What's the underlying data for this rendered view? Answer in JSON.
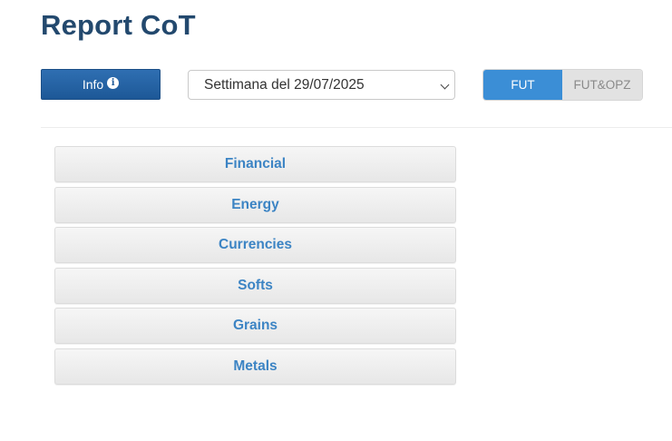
{
  "header": {
    "title": "Report CoT"
  },
  "toolbar": {
    "info_label": "Info",
    "info_icon": "info-circle-icon",
    "week_select": {
      "selected": "Settimana del 29/07/2025"
    },
    "mode_toggle": {
      "options": [
        {
          "label": "FUT",
          "active": true
        },
        {
          "label": "FUT&OPZ",
          "active": false
        }
      ],
      "active_color": "#3b8ed6",
      "inactive_color": "#e2e2e2"
    }
  },
  "categories": [
    {
      "label": "Financial"
    },
    {
      "label": "Energy"
    },
    {
      "label": "Currencies"
    },
    {
      "label": "Softs"
    },
    {
      "label": "Grains"
    },
    {
      "label": "Metals"
    }
  ],
  "colors": {
    "title": "#23496e",
    "primary_button": "#1d5897",
    "category_text": "#3c84c4"
  }
}
